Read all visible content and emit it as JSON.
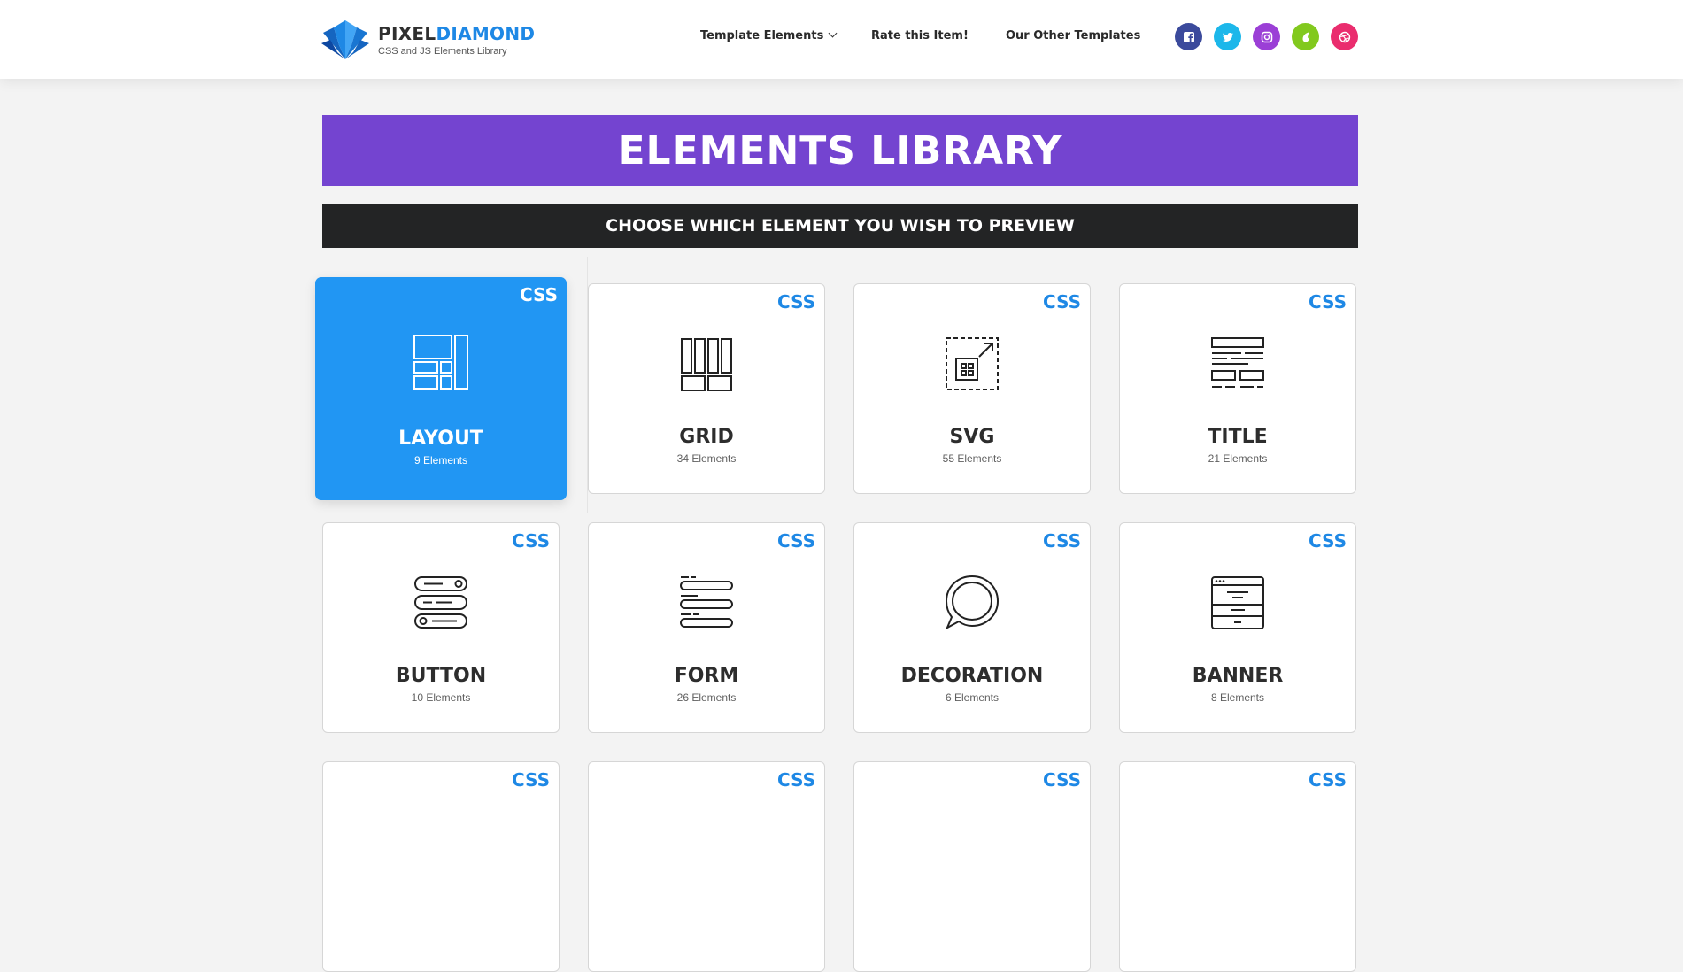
{
  "brand": {
    "name_part1": "PIXEL",
    "name_part2": "DIAMOND",
    "tagline": "CSS and JS Elements Library"
  },
  "nav": [
    {
      "label": "Template Elements",
      "has_dropdown": true
    },
    {
      "label": "Rate this Item!"
    },
    {
      "label": "Our Other Templates"
    }
  ],
  "socials": [
    {
      "name": "facebook-icon",
      "color": "#3b4a9c"
    },
    {
      "name": "twitter-icon",
      "color": "#1cb7ea"
    },
    {
      "name": "instagram-icon",
      "color": "#9b3fd6"
    },
    {
      "name": "envato-icon",
      "color": "#82c91e"
    },
    {
      "name": "dribbble-icon",
      "color": "#ea2d6e"
    }
  ],
  "hero": {
    "title": "ELEMENTS LIBRARY"
  },
  "subbar": {
    "title": "CHOOSE WHICH ELEMENT YOU WISH TO PREVIEW"
  },
  "cards": [
    {
      "badge": "CSS",
      "title": "LAYOUT",
      "count": "9 Elements",
      "icon": "layout-icon",
      "active": true
    },
    {
      "badge": "CSS",
      "title": "GRID",
      "count": "34 Elements",
      "icon": "grid-icon"
    },
    {
      "badge": "CSS",
      "title": "SVG",
      "count": "55 Elements",
      "icon": "svg-icon"
    },
    {
      "badge": "CSS",
      "title": "TITLE",
      "count": "21 Elements",
      "icon": "title-icon"
    },
    {
      "badge": "CSS",
      "title": "BUTTON",
      "count": "10 Elements",
      "icon": "button-icon"
    },
    {
      "badge": "CSS",
      "title": "FORM",
      "count": "26 Elements",
      "icon": "form-icon"
    },
    {
      "badge": "CSS",
      "title": "DECORATION",
      "count": "6 Elements",
      "icon": "decoration-icon"
    },
    {
      "badge": "CSS",
      "title": "BANNER",
      "count": "8 Elements",
      "icon": "banner-icon"
    },
    {
      "badge": "CSS"
    },
    {
      "badge": "CSS"
    },
    {
      "badge": "CSS"
    },
    {
      "badge": "CSS"
    }
  ]
}
